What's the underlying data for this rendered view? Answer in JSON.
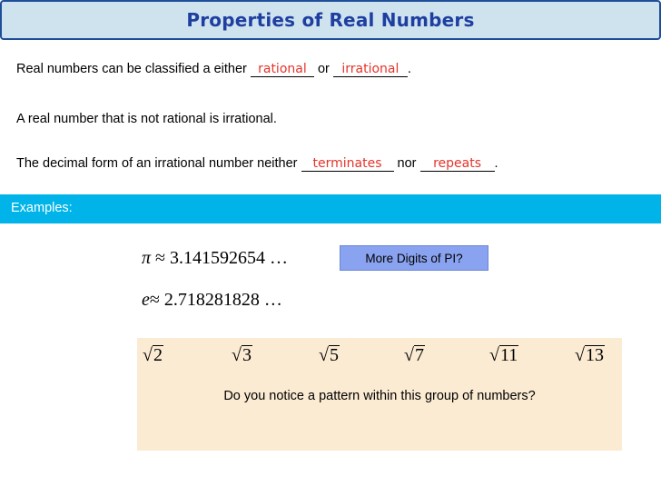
{
  "title": "Properties of Real Numbers",
  "line1": {
    "before": "Real numbers can be classified a either ",
    "blank1": "rational",
    "middle": " or ",
    "blank2": "irrational",
    "after": "."
  },
  "line2": "A real number that is not rational is irrational.",
  "line3": {
    "before": "The decimal form of an irrational number neither ",
    "blank1": "terminates",
    "middle": " nor ",
    "blank2": "repeats",
    "after": "."
  },
  "examples_label": "Examples:",
  "pi": {
    "symbol": "π",
    "approx": "≈",
    "value": "3.141592654 …"
  },
  "e": {
    "symbol": "e",
    "approx": "≈",
    "value": "2.718281828 …"
  },
  "pi_button": "More Digits of PI?",
  "roots": [
    "2",
    "3",
    "5",
    "7",
    "11",
    "13"
  ],
  "radical_symbol": "√",
  "question": "Do you notice a pattern within this group of numbers?",
  "colors": {
    "title": "#1f3fa0",
    "answer": "#e6332a",
    "band": "#00b4ea",
    "button": "#8aa3f0",
    "pattern_box": "#fbebd3"
  }
}
